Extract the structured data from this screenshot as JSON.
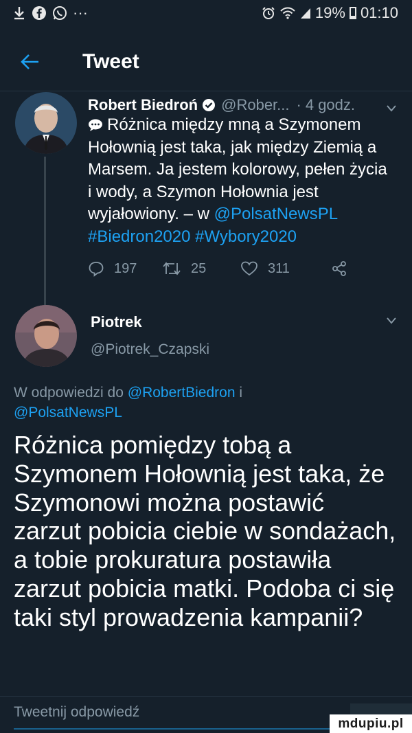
{
  "status_bar": {
    "battery_percent": "19%",
    "time": "01:10",
    "left_icons": [
      "download-icon",
      "facebook-icon",
      "whatsapp-icon",
      "more-dots-icon"
    ],
    "right_icons": [
      "alarm-icon",
      "wifi-icon",
      "signal-icon",
      "battery-icon"
    ],
    "more_text": "···"
  },
  "header": {
    "title": "Tweet"
  },
  "tweet1": {
    "name": "Robert Biedroń",
    "handle": "@Rober...",
    "separator": "·",
    "time": "4 godz.",
    "body_text": "Różnica między mną a Szymonem Hołownią jest taka, jak między Ziemią a Marsem. Ja jestem kolorowy, pełen życia i wody, a Szymon Hołownia jest wyjałowiony. – w",
    "mention": "@PolsatNewsPL",
    "hashtag1": "#Biedron2020",
    "hashtag2": "#Wybory2020",
    "reply_count": "197",
    "retweet_count": "25",
    "like_count": "311"
  },
  "tweet2": {
    "name": "Piotrek",
    "handle": "@Piotrek_Czapski",
    "reply_prefix": "W odpowiedzi do",
    "reply_mention1": "@RobertBiedron",
    "reply_and": "i",
    "reply_mention2": "@PolsatNewsPL",
    "body_text": "Różnica pomiędzy tobą a Szymonem Hołownią jest taka, że Szymonowi można postawić zarzut pobicia ciebie w sondażach, a tobie prokuratura postawiła zarzut pobicia matki. Podoba ci się taki styl prowadzenia kampanii?"
  },
  "reply_input": {
    "placeholder": "Tweetnij odpowiedź"
  },
  "watermark": {
    "text": "mdupiu.pl"
  },
  "colors": {
    "background": "#15202b",
    "link": "#1da1f2",
    "secondary_text": "#8899a6",
    "separator": "#253341"
  }
}
